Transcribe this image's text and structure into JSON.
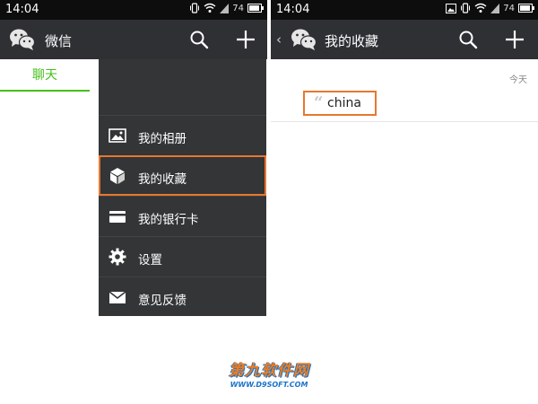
{
  "left": {
    "status": {
      "time": "14:04",
      "battery": "74"
    },
    "appbar": {
      "title": "微信",
      "icons": [
        "wechat-logo-icon",
        "search-icon",
        "plus-icon"
      ]
    },
    "tabs": [
      {
        "label": "聊天",
        "active": true
      }
    ],
    "menu": {
      "items": [
        {
          "label": "我的相册",
          "icon": "photo-album-icon"
        },
        {
          "label": "我的收藏",
          "icon": "cube-icon",
          "highlighted": true
        },
        {
          "label": "我的银行卡",
          "icon": "card-icon"
        },
        {
          "label": "设置",
          "icon": "gear-icon"
        },
        {
          "label": "意见反馈",
          "icon": "envelope-icon"
        }
      ]
    }
  },
  "right": {
    "status": {
      "time": "14:04",
      "battery": "74"
    },
    "appbar": {
      "back": "‹",
      "title": "我的收藏",
      "icons": [
        "wechat-logo-icon",
        "search-icon",
        "plus-icon"
      ]
    },
    "favorites": {
      "date": "今天",
      "items": [
        {
          "quote": "“",
          "text": "china",
          "highlighted": true
        }
      ]
    }
  },
  "watermark": {
    "main": "第九软件网",
    "sub": "WWW.D9SOFT.COM"
  },
  "colors": {
    "accent_green": "#45c01a",
    "highlight_orange": "#e8772e",
    "appbar_bg": "#2f3033",
    "menu_bg": "#333537"
  }
}
